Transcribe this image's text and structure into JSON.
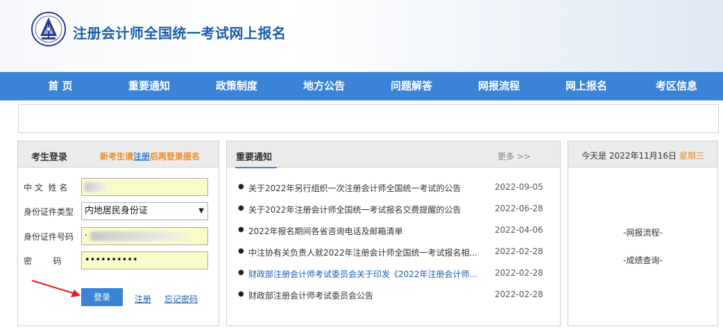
{
  "header": {
    "title": "注册会计师全国统一考试网上报名"
  },
  "nav": {
    "items": [
      "首 页",
      "重要通知",
      "政策制度",
      "地方公告",
      "问题解答",
      "网报流程",
      "网上报名",
      "考区信息"
    ]
  },
  "login": {
    "title": "考生登录",
    "hint_prefix": "新考生请",
    "hint_link": "注册",
    "hint_suffix": "后再登录报名",
    "name_label": "中 文  姓 名",
    "id_type_label": "身份证件类型",
    "id_type_value": "内地居民身份证",
    "id_number_label": "身份证件号码",
    "id_number_value": "·",
    "password_label": "密        码",
    "password_value": "••••••••••",
    "login_button": "登录",
    "register_link": "注册",
    "forgot_link": "忘记密码"
  },
  "notice": {
    "title": "重要通知",
    "more": "更多 >>",
    "items": [
      {
        "text": "关于2022年另行组织一次注册会计师全国统一考试的公告",
        "date": "2022-09-05"
      },
      {
        "text": "关于2022年注册会计师全国统一考试报名交费提醒的公告",
        "date": "2022-06-28"
      },
      {
        "text": "2022年报名期间各省咨询电话及邮箱清单",
        "date": "2022-04-06"
      },
      {
        "text": "中注协有关负责人就2022年注册会计师全国统一考试报名相...",
        "date": "2022-02-28"
      },
      {
        "text": "财政部注册会计师考试委员会关于印发《2022年注册会计师...",
        "date": "2022-02-28"
      },
      {
        "text": "财政部注册会计师考试委员会公告",
        "date": "2022-02-28"
      }
    ]
  },
  "side": {
    "date_prefix": "今天是 2022年11月16日",
    "weekday": "星期三",
    "links": [
      "-网报流程-",
      "-成绩查询-"
    ]
  },
  "colors": {
    "nav_bg": "#3a83d6",
    "title": "#1b5ea8",
    "accent_orange": "#f08a1c",
    "input_bg": "#fbfbc9"
  }
}
